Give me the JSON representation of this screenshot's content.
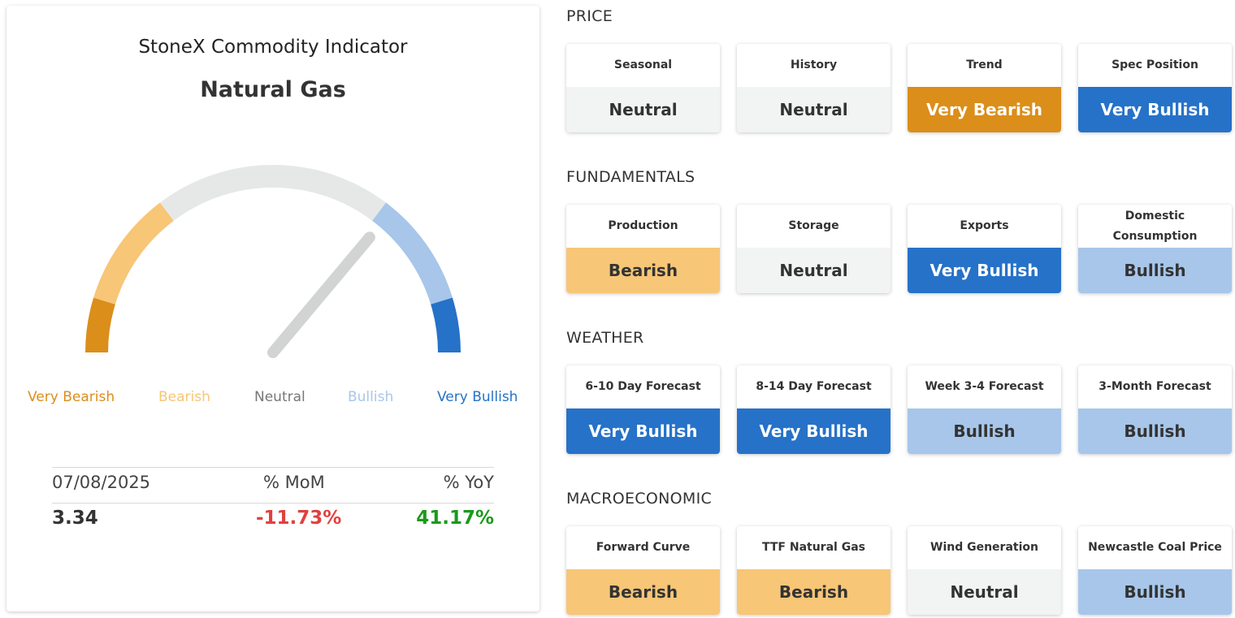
{
  "header": {
    "title": "StoneX Commodity Indicator",
    "commodity": "Natural Gas"
  },
  "gauge": {
    "value_label": "Bullish",
    "needle_position_fraction": 0.75,
    "scale": [
      "Very Bearish",
      "Bearish",
      "Neutral",
      "Bullish",
      "Very Bullish"
    ],
    "colors": {
      "very_bearish": "#db8e1a",
      "bearish": "#f7c676",
      "neutral": "#e6e8e7",
      "bullish": "#a7c6e9",
      "very_bullish": "#2672c8",
      "needle": "#d2d4d4"
    }
  },
  "stats": {
    "date": "07/08/2025",
    "mom_label": "% MoM",
    "yoy_label": "% YoY",
    "price": "3.34",
    "mom": "-11.73%",
    "yoy": "41.17%",
    "mom_color": "#e0413e",
    "yoy_color": "#1a9a1a"
  },
  "sections": [
    {
      "title": "PRICE",
      "tiles": [
        {
          "label": "Seasonal",
          "value": "Neutral",
          "level": "neutral"
        },
        {
          "label": "History",
          "value": "Neutral",
          "level": "neutral"
        },
        {
          "label": "Trend",
          "value": "Very Bearish",
          "level": "very-bearish"
        },
        {
          "label": "Spec Position",
          "value": "Very Bullish",
          "level": "very-bullish"
        }
      ]
    },
    {
      "title": "FUNDAMENTALS",
      "tiles": [
        {
          "label": "Production",
          "value": "Bearish",
          "level": "bearish"
        },
        {
          "label": "Storage",
          "value": "Neutral",
          "level": "neutral"
        },
        {
          "label": "Exports",
          "value": "Very Bullish",
          "level": "very-bullish"
        },
        {
          "label": "Domestic Consumption",
          "value": "Bullish",
          "level": "bullish"
        }
      ]
    },
    {
      "title": "WEATHER",
      "tiles": [
        {
          "label": "6-10 Day Forecast",
          "value": "Very Bullish",
          "level": "very-bullish"
        },
        {
          "label": "8-14 Day Forecast",
          "value": "Very Bullish",
          "level": "very-bullish"
        },
        {
          "label": "Week 3-4 Forecast",
          "value": "Bullish",
          "level": "bullish"
        },
        {
          "label": "3-Month Forecast",
          "value": "Bullish",
          "level": "bullish"
        }
      ]
    },
    {
      "title": "MACROECONOMIC",
      "tiles": [
        {
          "label": "Forward Curve",
          "value": "Bearish",
          "level": "bearish"
        },
        {
          "label": "TTF Natural Gas",
          "value": "Bearish",
          "level": "bearish"
        },
        {
          "label": "Wind Generation",
          "value": "Neutral",
          "level": "neutral"
        },
        {
          "label": "Newcastle Coal Price",
          "value": "Bullish",
          "level": "bullish"
        }
      ]
    }
  ]
}
